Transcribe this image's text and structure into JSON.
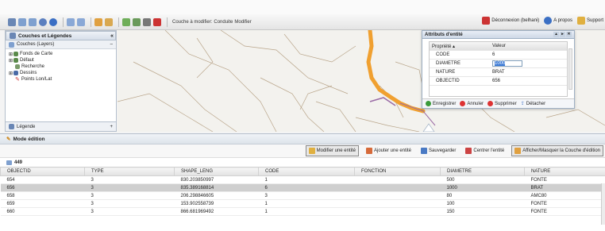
{
  "toolbar": {
    "edit_layer_label": "Couche à modifier:",
    "edit_layer_value": "Conduite",
    "edit_action": "Modifier",
    "logout_label": "Déconnexion (belhani)",
    "about_label": "A propos",
    "support_label": "Support"
  },
  "left_panel": {
    "title": "Couches et Légendes",
    "layers_header": "Couches (Layers)",
    "tree": [
      {
        "label": "Fonds de Carte"
      },
      {
        "label": "Défaut"
      },
      {
        "label": "Recherche"
      },
      {
        "label": "Dessins"
      },
      {
        "label": "Points Lon/Lat"
      }
    ],
    "legend_label": "Légende"
  },
  "attr_window": {
    "title": "Attributs d'entité",
    "col_property": "Propriété",
    "col_value": "Valeur",
    "rows": [
      {
        "key": "CODE",
        "value": "6"
      },
      {
        "key": "DIAMETRE",
        "value": "1000"
      },
      {
        "key": "NATURE",
        "value": "BRAT"
      },
      {
        "key": "OBJECTID",
        "value": "656"
      }
    ],
    "buttons": {
      "save": "Enregistrer",
      "cancel": "Annuler",
      "delete": "Supprimer",
      "detach": "Détacher"
    }
  },
  "edit_mode": {
    "title": "Mode édition",
    "buttons": {
      "edit_entity": "Modifier une entité",
      "add_entity": "Ajouter une entité",
      "save": "Sauvegarder",
      "center": "Centrer l'entité",
      "toggle_layer": "Afficher/Masquer la Couche d'édition"
    },
    "record_count": "449"
  },
  "table": {
    "columns": [
      "OBJECTID",
      "TYPE",
      "SHAPE_LENG",
      "CODE",
      "FONCTION",
      "DIAMETRE",
      "NATURE"
    ],
    "rows": [
      [
        "654",
        "3",
        "830.203850997",
        "1",
        "",
        "500",
        "FONTE"
      ],
      [
        "656",
        "3",
        "835.389168814",
        "6",
        "",
        "1000",
        "BRAT"
      ],
      [
        "658",
        "3",
        "206.298846605",
        "3",
        "",
        "80",
        "AMC80"
      ],
      [
        "659",
        "3",
        "153.902558739",
        "1",
        "",
        "100",
        "FONTE"
      ],
      [
        "660",
        "3",
        "866.681969492",
        "1",
        "",
        "150",
        "FONTE"
      ]
    ]
  },
  "colors": {
    "accent": "#f0a030",
    "selected_row": "#cfcfcf",
    "panel_header": "#d6dee9"
  }
}
